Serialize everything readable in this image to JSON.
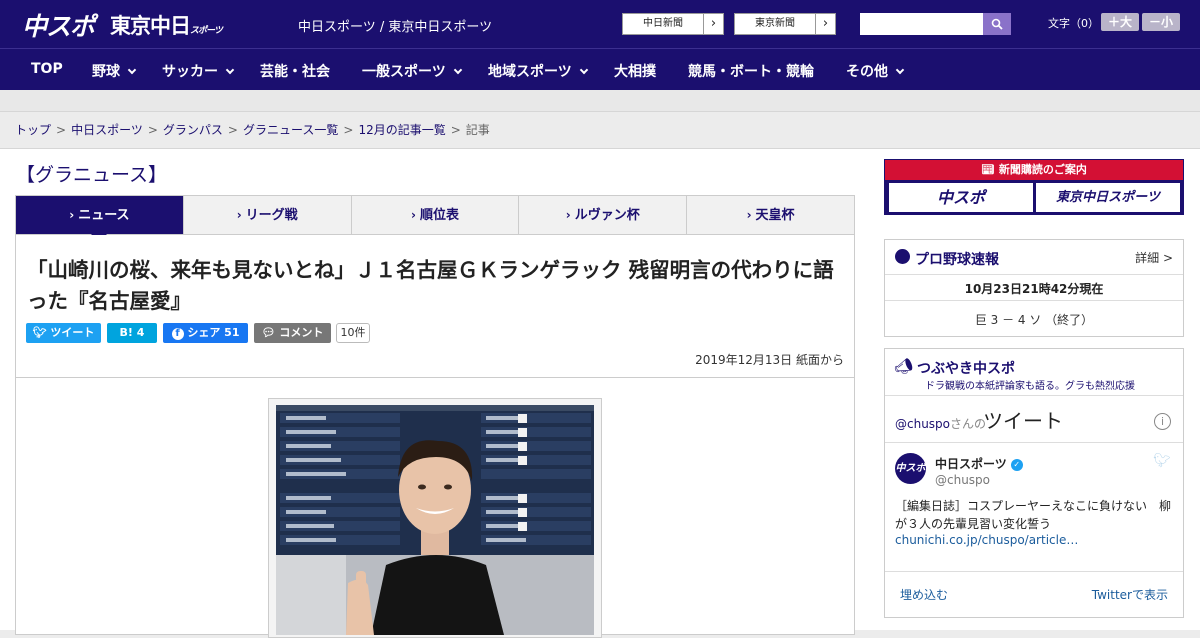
{
  "header": {
    "logo_chuspo": "中スポ",
    "logo_tokyo": "東京中日",
    "logo_tokyo_small": "スポーツ",
    "site_name": "中日スポーツ / 東京中日スポーツ",
    "link_chunichi": "中日新聞",
    "link_tokyo": "東京新聞",
    "search_icon": "search-icon",
    "font_label": "文字（0）",
    "font_larger": "＋大",
    "font_smaller": "－小"
  },
  "nav": {
    "items": [
      {
        "label": "TOP"
      },
      {
        "label": "野球"
      },
      {
        "label": "サッカー"
      },
      {
        "label": "芸能・社会"
      },
      {
        "label": "一般スポーツ"
      },
      {
        "label": "地域スポーツ"
      },
      {
        "label": "大相撲"
      },
      {
        "label": "競馬・ボート・競輪"
      },
      {
        "label": "その他"
      }
    ]
  },
  "breadcrumb": {
    "items": [
      "トップ",
      "中日スポーツ",
      "グランパス",
      "グラニュース一覧",
      "12月の記事一覧"
    ],
    "current": "記事",
    "sep": ">"
  },
  "section": {
    "title": "【グラニュース】"
  },
  "tabs": [
    {
      "label": "ニュース"
    },
    {
      "label": "リーグ戦"
    },
    {
      "label": "順位表"
    },
    {
      "label": "ルヴァン杯"
    },
    {
      "label": "天皇杯"
    }
  ],
  "article": {
    "headline": "「山崎川の桜、来年も見ないとね」Ｊ１名古屋ＧＫランゲラック 残留明言の代わりに語った『名古屋愛』",
    "share_tweet": "ツイート",
    "share_hatena": "B! 4",
    "share_fb": "シェア 51",
    "share_comment": "コメント",
    "comment_count": "10件",
    "date": "2019年12月13日 紙面から"
  },
  "sidebar": {
    "ad": {
      "title": "新聞購読のご案内",
      "logo1": "中スポ",
      "logo2": "東京中日スポーツ"
    },
    "baseball": {
      "title": "プロ野球速報",
      "more": "詳細 >",
      "time": "10月23日21時42分現在",
      "score": "巨 3 － 4 ソ （終了）"
    },
    "tsubuyaki": {
      "title": "つぶやき中スポ",
      "sub": "ドラ観戦の本紙評論家も語る。グラも熱烈応援",
      "handle": "@chuspo",
      "handle_suffix": "さんの",
      "heading": "ツイート",
      "info": "i",
      "avatar": "中スポ",
      "name": "中日スポーツ",
      "user": "@chuspo",
      "text": "［編集日誌］コスプレーヤーえなこに負けない　柳が３人の先輩見習い変化誓う",
      "link": "chunichi.co.jp/chuspo/article…",
      "embed": "埋め込む",
      "view": "Twitterで表示"
    }
  }
}
